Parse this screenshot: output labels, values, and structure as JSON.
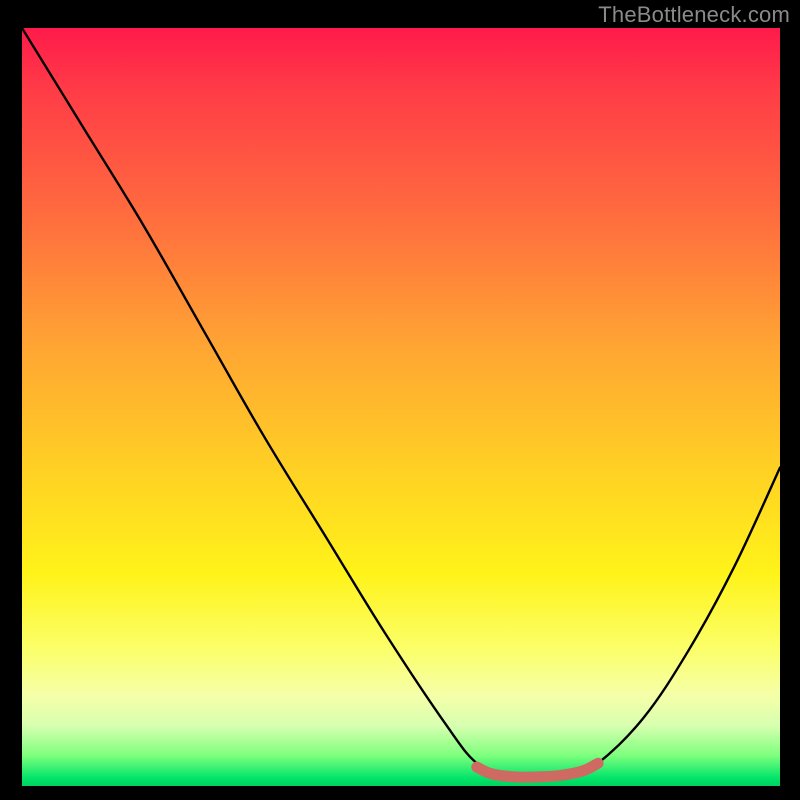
{
  "watermark": "TheBottleneck.com",
  "chart_data": {
    "type": "line",
    "title": "",
    "xlabel": "",
    "ylabel": "",
    "xlim": [
      0,
      100
    ],
    "ylim": [
      0,
      100
    ],
    "series": [
      {
        "name": "bottleneck-curve",
        "x": [
          0,
          8,
          16,
          24,
          32,
          40,
          48,
          56,
          60,
          64,
          68,
          72,
          76,
          82,
          88,
          94,
          100
        ],
        "y": [
          100,
          87,
          74,
          60,
          46,
          33,
          20,
          8,
          3,
          1,
          1,
          1,
          3,
          9,
          18,
          29,
          42
        ]
      },
      {
        "name": "optimal-range",
        "x": [
          60,
          62,
          65,
          68,
          71,
          74,
          76
        ],
        "y": [
          2.5,
          1.6,
          1.2,
          1.2,
          1.4,
          2.0,
          3.0
        ]
      }
    ],
    "colors": {
      "curve": "#000000",
      "optimal": "#cf6a63",
      "gradient_top": "#ff1a4b",
      "gradient_bottom": "#00d25f"
    }
  }
}
